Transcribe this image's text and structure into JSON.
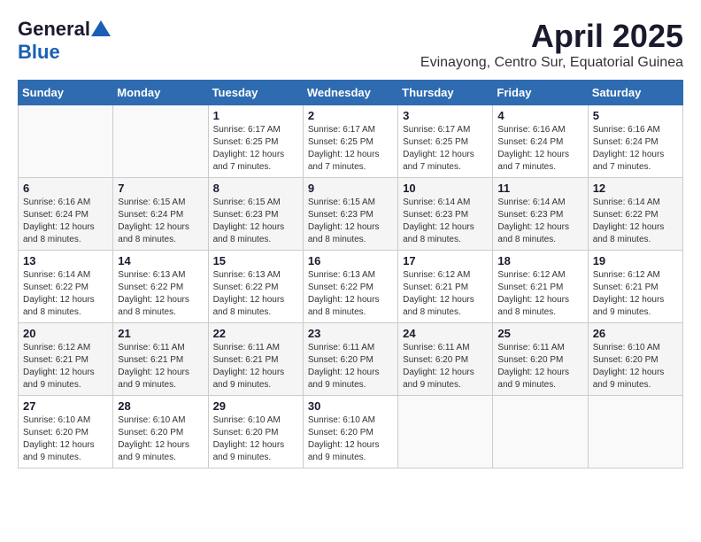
{
  "header": {
    "logo_general": "General",
    "logo_blue": "Blue",
    "month_year": "April 2025",
    "location": "Evinayong, Centro Sur, Equatorial Guinea"
  },
  "weekdays": [
    "Sunday",
    "Monday",
    "Tuesday",
    "Wednesday",
    "Thursday",
    "Friday",
    "Saturday"
  ],
  "weeks": [
    [
      {
        "day": "",
        "info": ""
      },
      {
        "day": "",
        "info": ""
      },
      {
        "day": "1",
        "info": "Sunrise: 6:17 AM\nSunset: 6:25 PM\nDaylight: 12 hours and 7 minutes."
      },
      {
        "day": "2",
        "info": "Sunrise: 6:17 AM\nSunset: 6:25 PM\nDaylight: 12 hours and 7 minutes."
      },
      {
        "day": "3",
        "info": "Sunrise: 6:17 AM\nSunset: 6:25 PM\nDaylight: 12 hours and 7 minutes."
      },
      {
        "day": "4",
        "info": "Sunrise: 6:16 AM\nSunset: 6:24 PM\nDaylight: 12 hours and 7 minutes."
      },
      {
        "day": "5",
        "info": "Sunrise: 6:16 AM\nSunset: 6:24 PM\nDaylight: 12 hours and 7 minutes."
      }
    ],
    [
      {
        "day": "6",
        "info": "Sunrise: 6:16 AM\nSunset: 6:24 PM\nDaylight: 12 hours and 8 minutes."
      },
      {
        "day": "7",
        "info": "Sunrise: 6:15 AM\nSunset: 6:24 PM\nDaylight: 12 hours and 8 minutes."
      },
      {
        "day": "8",
        "info": "Sunrise: 6:15 AM\nSunset: 6:23 PM\nDaylight: 12 hours and 8 minutes."
      },
      {
        "day": "9",
        "info": "Sunrise: 6:15 AM\nSunset: 6:23 PM\nDaylight: 12 hours and 8 minutes."
      },
      {
        "day": "10",
        "info": "Sunrise: 6:14 AM\nSunset: 6:23 PM\nDaylight: 12 hours and 8 minutes."
      },
      {
        "day": "11",
        "info": "Sunrise: 6:14 AM\nSunset: 6:23 PM\nDaylight: 12 hours and 8 minutes."
      },
      {
        "day": "12",
        "info": "Sunrise: 6:14 AM\nSunset: 6:22 PM\nDaylight: 12 hours and 8 minutes."
      }
    ],
    [
      {
        "day": "13",
        "info": "Sunrise: 6:14 AM\nSunset: 6:22 PM\nDaylight: 12 hours and 8 minutes."
      },
      {
        "day": "14",
        "info": "Sunrise: 6:13 AM\nSunset: 6:22 PM\nDaylight: 12 hours and 8 minutes."
      },
      {
        "day": "15",
        "info": "Sunrise: 6:13 AM\nSunset: 6:22 PM\nDaylight: 12 hours and 8 minutes."
      },
      {
        "day": "16",
        "info": "Sunrise: 6:13 AM\nSunset: 6:22 PM\nDaylight: 12 hours and 8 minutes."
      },
      {
        "day": "17",
        "info": "Sunrise: 6:12 AM\nSunset: 6:21 PM\nDaylight: 12 hours and 8 minutes."
      },
      {
        "day": "18",
        "info": "Sunrise: 6:12 AM\nSunset: 6:21 PM\nDaylight: 12 hours and 8 minutes."
      },
      {
        "day": "19",
        "info": "Sunrise: 6:12 AM\nSunset: 6:21 PM\nDaylight: 12 hours and 9 minutes."
      }
    ],
    [
      {
        "day": "20",
        "info": "Sunrise: 6:12 AM\nSunset: 6:21 PM\nDaylight: 12 hours and 9 minutes."
      },
      {
        "day": "21",
        "info": "Sunrise: 6:11 AM\nSunset: 6:21 PM\nDaylight: 12 hours and 9 minutes."
      },
      {
        "day": "22",
        "info": "Sunrise: 6:11 AM\nSunset: 6:21 PM\nDaylight: 12 hours and 9 minutes."
      },
      {
        "day": "23",
        "info": "Sunrise: 6:11 AM\nSunset: 6:20 PM\nDaylight: 12 hours and 9 minutes."
      },
      {
        "day": "24",
        "info": "Sunrise: 6:11 AM\nSunset: 6:20 PM\nDaylight: 12 hours and 9 minutes."
      },
      {
        "day": "25",
        "info": "Sunrise: 6:11 AM\nSunset: 6:20 PM\nDaylight: 12 hours and 9 minutes."
      },
      {
        "day": "26",
        "info": "Sunrise: 6:10 AM\nSunset: 6:20 PM\nDaylight: 12 hours and 9 minutes."
      }
    ],
    [
      {
        "day": "27",
        "info": "Sunrise: 6:10 AM\nSunset: 6:20 PM\nDaylight: 12 hours and 9 minutes."
      },
      {
        "day": "28",
        "info": "Sunrise: 6:10 AM\nSunset: 6:20 PM\nDaylight: 12 hours and 9 minutes."
      },
      {
        "day": "29",
        "info": "Sunrise: 6:10 AM\nSunset: 6:20 PM\nDaylight: 12 hours and 9 minutes."
      },
      {
        "day": "30",
        "info": "Sunrise: 6:10 AM\nSunset: 6:20 PM\nDaylight: 12 hours and 9 minutes."
      },
      {
        "day": "",
        "info": ""
      },
      {
        "day": "",
        "info": ""
      },
      {
        "day": "",
        "info": ""
      }
    ]
  ]
}
